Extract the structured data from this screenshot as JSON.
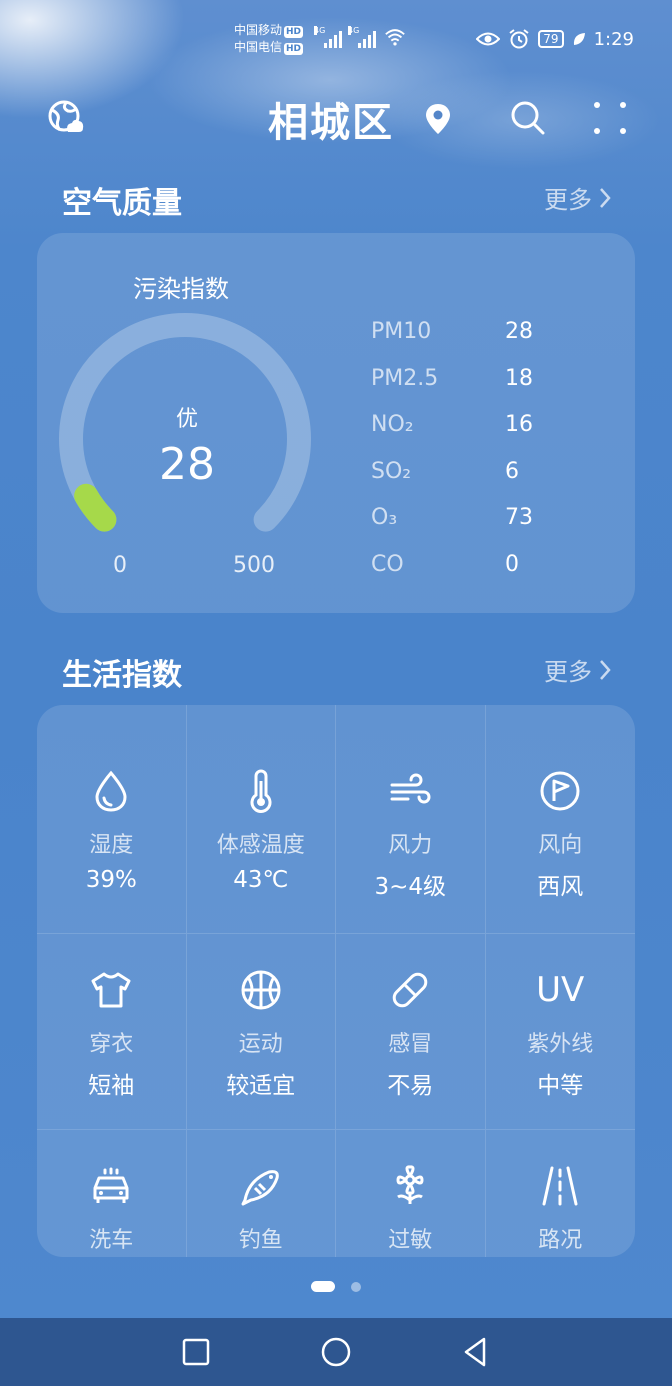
{
  "status_bar": {
    "carrier1": "中国移动",
    "carrier2": "中国电信",
    "hd_badge": "HD",
    "net1": "4G",
    "net2": "4G",
    "wifi_tag": "6",
    "battery": "79",
    "time": "1:29"
  },
  "header": {
    "city": "相城区"
  },
  "air_quality": {
    "title": "空气质量",
    "more": "更多",
    "card_label": "污染指数",
    "level": "优",
    "value": "28",
    "gauge_min": "0",
    "gauge_max": "500",
    "gauge_fraction": 0.056,
    "gauge_color": "#a6d94a",
    "pollutants": [
      {
        "name": "PM10",
        "value": "28"
      },
      {
        "name": "PM2.5",
        "value": "18"
      },
      {
        "name": "NO₂",
        "value": "16"
      },
      {
        "name": "SO₂",
        "value": "6"
      },
      {
        "name": "O₃",
        "value": "73"
      },
      {
        "name": "CO",
        "value": "0"
      }
    ]
  },
  "life_index": {
    "title": "生活指数",
    "more": "更多",
    "items": [
      {
        "icon": "droplet-icon",
        "label": "湿度",
        "value": "39%"
      },
      {
        "icon": "thermometer-icon",
        "label": "体感温度",
        "value": "43℃"
      },
      {
        "icon": "wind-icon",
        "label": "风力",
        "value": "3~4级"
      },
      {
        "icon": "wind-direction-flag-icon",
        "label": "风向",
        "value": "西风"
      },
      {
        "icon": "tshirt-icon",
        "label": "穿衣",
        "value": "短袖"
      },
      {
        "icon": "basketball-icon",
        "label": "运动",
        "value": "较适宜"
      },
      {
        "icon": "pill-icon",
        "label": "感冒",
        "value": "不易"
      },
      {
        "icon": "uv-icon",
        "label": "紫外线",
        "value": "中等",
        "icon_text": "UV"
      },
      {
        "icon": "car-wash-icon",
        "label": "洗车",
        "value": ""
      },
      {
        "icon": "fish-icon",
        "label": "钓鱼",
        "value": ""
      },
      {
        "icon": "flower-icon",
        "label": "过敏",
        "value": ""
      },
      {
        "icon": "road-icon",
        "label": "路况",
        "value": ""
      }
    ]
  },
  "pager": {
    "active_page": 1,
    "total_pages": 2
  }
}
